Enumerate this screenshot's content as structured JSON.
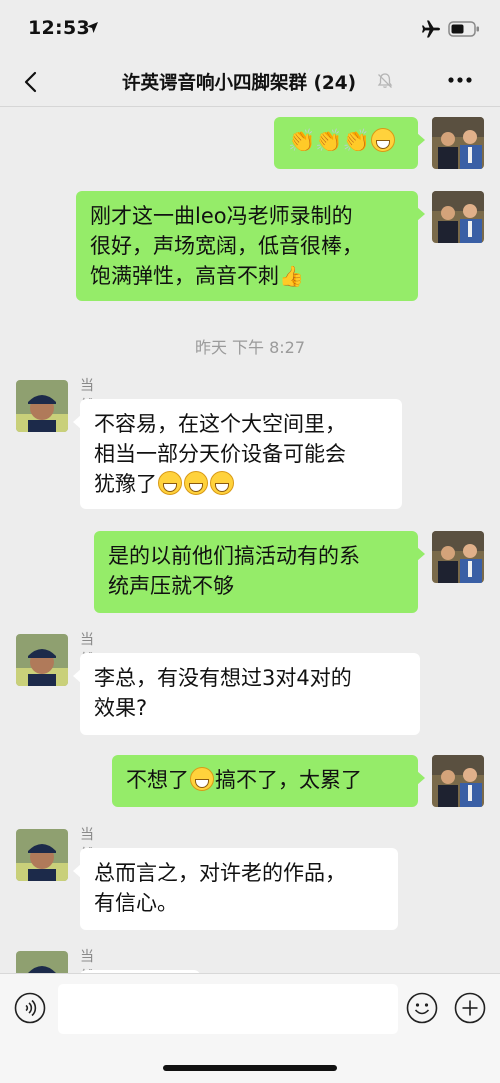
{
  "status_bar": {
    "time": "12:53"
  },
  "nav": {
    "title": "许英谔音响小四脚架群 (24)"
  },
  "messages": [
    {
      "self": true,
      "text": ""
    },
    {
      "self": true,
      "text": "刚才这一曲leo冯老师录制的\n很好，声场宽阔，低音很棒，\n饱满弹性，高音不刺"
    },
    {
      "timestamp": "昨天 下午 8:27"
    },
    {
      "self": false,
      "sender": "当然",
      "text": "不容易，在这个大空间里，\n相当一部分天价设备可能会\n犹豫了"
    },
    {
      "self": true,
      "text": "是的以前他们搞活动有的系\n统声压就不够"
    },
    {
      "self": false,
      "sender": "当然",
      "text": "李总，有没有想过3对4对的\n效果?"
    },
    {
      "self": true,
      "text_before": "不想了",
      "text_after": "搞不了，太累了"
    },
    {
      "self": false,
      "sender": "当然",
      "text": "总而言之，对许老的作品，\n有信心。"
    },
    {
      "self": false,
      "sender": "当然",
      "text": ""
    }
  ]
}
